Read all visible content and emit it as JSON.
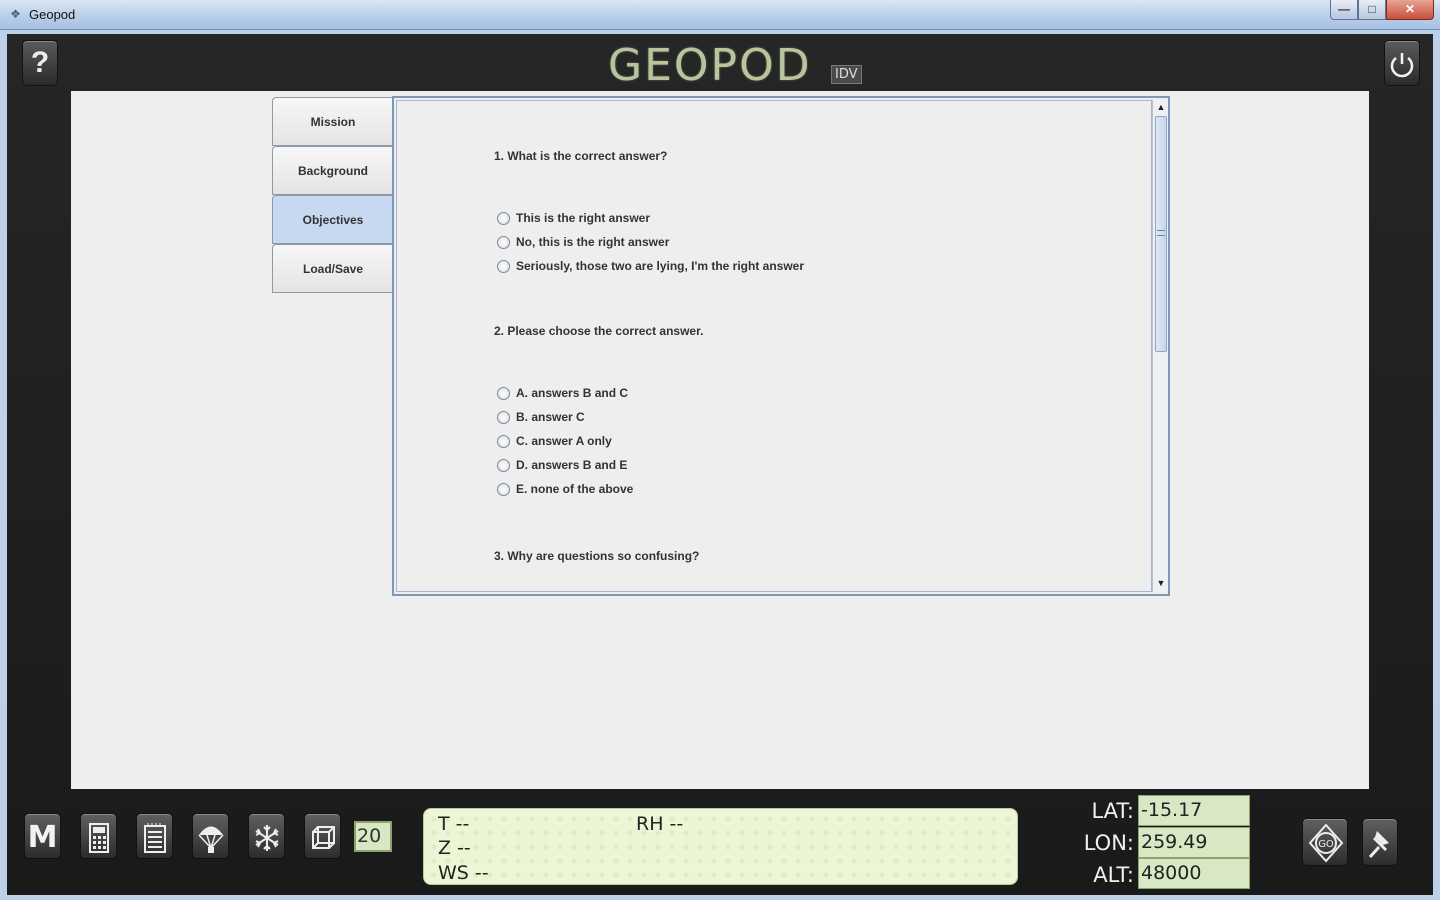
{
  "window": {
    "title": "Geopod",
    "min_label": "—",
    "max_label": "□",
    "close_label": "✕"
  },
  "header": {
    "logo": "GEOPOD",
    "logo_badge": "IDV",
    "help_label": "?"
  },
  "tabs": [
    {
      "label": "Mission"
    },
    {
      "label": "Background"
    },
    {
      "label": "Objectives"
    },
    {
      "label": "Load/Save"
    }
  ],
  "questions": [
    {
      "text": "1. What is the correct answer?",
      "options": [
        "This is the right answer",
        "No, this is the right answer",
        "Seriously, those two are lying, I'm the right answer"
      ]
    },
    {
      "text": "2. Please choose the correct answer.",
      "options": [
        "A. answers B and C",
        "B. answer C",
        "C. answer A only",
        "D. answers B and E",
        "E. none of the above"
      ]
    },
    {
      "text": "3. Why are questions so confusing?",
      "options": []
    }
  ],
  "toolbar": {
    "m_label": "M",
    "step_value": "20"
  },
  "readout": {
    "t": "T  --",
    "rh": "RH  --",
    "z": "Z  --",
    "ws": "WS  --"
  },
  "coords": {
    "lat_label": "LAT:",
    "lat_value": "-15.17",
    "lon_label": "LON:",
    "lon_value": "259.49",
    "alt_label": "ALT:",
    "alt_value": "48000"
  },
  "go_label": "GO",
  "colors": {
    "active_tab": "#c6d9f0",
    "lcd_green": "#d9e8c4",
    "logo": "#b8c59c"
  }
}
